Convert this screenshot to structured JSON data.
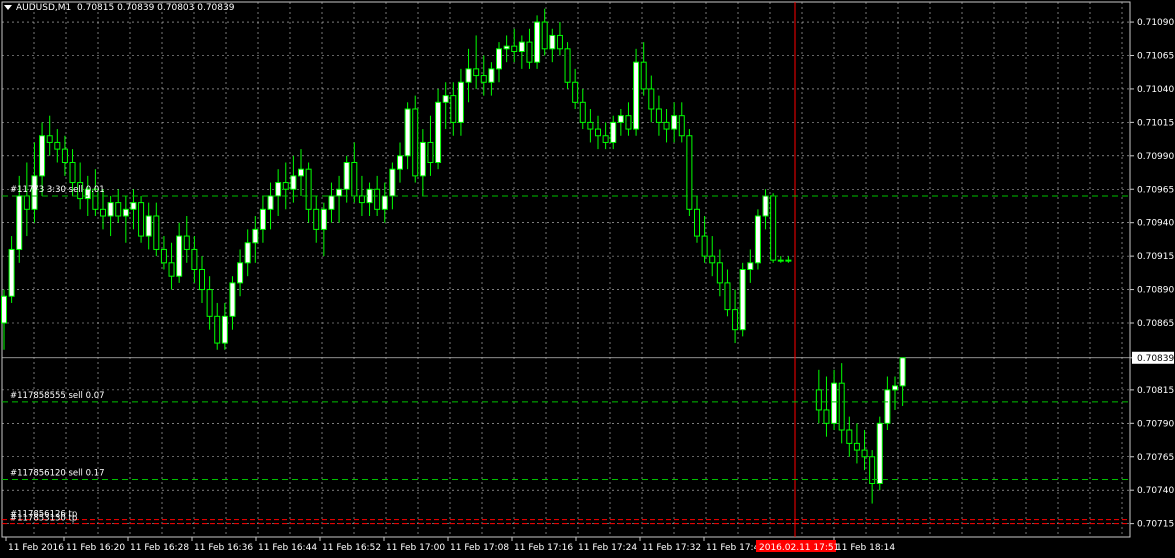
{
  "header": {
    "symbol_period": "AUDUSD,M1",
    "ohlc": "0.70815 0.70839 0.70803 0.70839"
  },
  "colors": {
    "background": "#000000",
    "grid": "#c8c8c8",
    "candle_up": "#ffffff",
    "candle_down_body": "#000000",
    "wick": "#00ff00",
    "order_line": "#00c000",
    "stop_line": "#ff0000",
    "vline": "#ff0000",
    "axis_text": "#ffffff",
    "time_marker_bg": "#ff0000"
  },
  "chart_data": {
    "type": "candlestick",
    "symbol": "AUDUSD",
    "timeframe": "M1",
    "ylim": [
      0.70705,
      0.71105
    ],
    "y_ticks": [
      "0.71090",
      "0.71065",
      "0.71040",
      "0.71015",
      "0.70990",
      "0.70965",
      "0.70940",
      "0.70915",
      "0.70890",
      "0.70865",
      "0.70839",
      "0.70815",
      "0.70790",
      "0.70765",
      "0.70740",
      "0.70715"
    ],
    "current_price": "0.70839",
    "x_ticks": [
      "11 Feb 2016",
      "11 Feb 16:20",
      "11 Feb 16:28",
      "11 Feb 16:36",
      "11 Feb 16:44",
      "11 Feb 16:52",
      "11 Feb 17:00",
      "11 Feb 17:08",
      "11 Feb 17:16",
      "11 Feb 17:24",
      "11 Feb 17:32",
      "11 Feb 17:4",
      "11 Feb 18:14"
    ],
    "time_marker": "2016.02.11 17:51",
    "orders": [
      {
        "label": "#11773 3:30 sell 0.01",
        "price": 0.7096
      },
      {
        "label": "#117858555 sell 0.07",
        "price": 0.70806
      },
      {
        "label": "#117856120 sell 0.17",
        "price": 0.70748
      },
      {
        "label": "#117856126 tp",
        "price": 0.70718
      },
      {
        "label": "#117853130 tp",
        "price": 0.70715
      }
    ],
    "candles": [
      {
        "o": 0.70865,
        "h": 0.7089,
        "l": 0.70845,
        "c": 0.70885
      },
      {
        "o": 0.70885,
        "h": 0.7093,
        "l": 0.7088,
        "c": 0.7092
      },
      {
        "o": 0.7092,
        "h": 0.70975,
        "l": 0.7091,
        "c": 0.7096
      },
      {
        "o": 0.7096,
        "h": 0.70985,
        "l": 0.7093,
        "c": 0.7095
      },
      {
        "o": 0.7095,
        "h": 0.71,
        "l": 0.7094,
        "c": 0.70975
      },
      {
        "o": 0.70975,
        "h": 0.71015,
        "l": 0.7096,
        "c": 0.71005
      },
      {
        "o": 0.71005,
        "h": 0.7102,
        "l": 0.7099,
        "c": 0.71
      },
      {
        "o": 0.71,
        "h": 0.7101,
        "l": 0.70985,
        "c": 0.70995
      },
      {
        "o": 0.70995,
        "h": 0.71005,
        "l": 0.70975,
        "c": 0.70985
      },
      {
        "o": 0.70985,
        "h": 0.70995,
        "l": 0.7096,
        "c": 0.7097
      },
      {
        "o": 0.7097,
        "h": 0.70985,
        "l": 0.7095,
        "c": 0.70958
      },
      {
        "o": 0.70958,
        "h": 0.70975,
        "l": 0.70945,
        "c": 0.70965
      },
      {
        "o": 0.70965,
        "h": 0.7098,
        "l": 0.70945,
        "c": 0.7095
      },
      {
        "o": 0.7095,
        "h": 0.70965,
        "l": 0.70935,
        "c": 0.70945
      },
      {
        "o": 0.70945,
        "h": 0.7096,
        "l": 0.7093,
        "c": 0.70955
      },
      {
        "o": 0.70955,
        "h": 0.70965,
        "l": 0.7094,
        "c": 0.70945
      },
      {
        "o": 0.70945,
        "h": 0.7096,
        "l": 0.70925,
        "c": 0.7095
      },
      {
        "o": 0.7095,
        "h": 0.70965,
        "l": 0.70935,
        "c": 0.70955
      },
      {
        "o": 0.70955,
        "h": 0.7096,
        "l": 0.70925,
        "c": 0.7093
      },
      {
        "o": 0.7093,
        "h": 0.70955,
        "l": 0.7092,
        "c": 0.70945
      },
      {
        "o": 0.70945,
        "h": 0.70955,
        "l": 0.70915,
        "c": 0.7092
      },
      {
        "o": 0.7092,
        "h": 0.7093,
        "l": 0.70905,
        "c": 0.7091
      },
      {
        "o": 0.7091,
        "h": 0.70925,
        "l": 0.7089,
        "c": 0.709
      },
      {
        "o": 0.709,
        "h": 0.7094,
        "l": 0.70895,
        "c": 0.7093
      },
      {
        "o": 0.7093,
        "h": 0.70945,
        "l": 0.7091,
        "c": 0.7092
      },
      {
        "o": 0.7092,
        "h": 0.7093,
        "l": 0.70895,
        "c": 0.70905
      },
      {
        "o": 0.70905,
        "h": 0.70915,
        "l": 0.7088,
        "c": 0.7089
      },
      {
        "o": 0.7089,
        "h": 0.709,
        "l": 0.7086,
        "c": 0.7087
      },
      {
        "o": 0.7087,
        "h": 0.7088,
        "l": 0.70845,
        "c": 0.7085
      },
      {
        "o": 0.7085,
        "h": 0.7088,
        "l": 0.70845,
        "c": 0.7087
      },
      {
        "o": 0.7087,
        "h": 0.709,
        "l": 0.7086,
        "c": 0.70895
      },
      {
        "o": 0.70895,
        "h": 0.7092,
        "l": 0.70885,
        "c": 0.7091
      },
      {
        "o": 0.7091,
        "h": 0.70935,
        "l": 0.709,
        "c": 0.70925
      },
      {
        "o": 0.70925,
        "h": 0.70945,
        "l": 0.7091,
        "c": 0.70935
      },
      {
        "o": 0.70935,
        "h": 0.7096,
        "l": 0.70925,
        "c": 0.7095
      },
      {
        "o": 0.7095,
        "h": 0.7097,
        "l": 0.70935,
        "c": 0.7096
      },
      {
        "o": 0.7096,
        "h": 0.7098,
        "l": 0.70945,
        "c": 0.7097
      },
      {
        "o": 0.7097,
        "h": 0.70985,
        "l": 0.7095,
        "c": 0.70965
      },
      {
        "o": 0.70965,
        "h": 0.7099,
        "l": 0.70955,
        "c": 0.70975
      },
      {
        "o": 0.70975,
        "h": 0.70995,
        "l": 0.7096,
        "c": 0.7098
      },
      {
        "o": 0.7098,
        "h": 0.70985,
        "l": 0.7094,
        "c": 0.7095
      },
      {
        "o": 0.7095,
        "h": 0.7096,
        "l": 0.70925,
        "c": 0.70935
      },
      {
        "o": 0.70935,
        "h": 0.70955,
        "l": 0.70915,
        "c": 0.7095
      },
      {
        "o": 0.7095,
        "h": 0.7097,
        "l": 0.7094,
        "c": 0.7096
      },
      {
        "o": 0.7096,
        "h": 0.70975,
        "l": 0.7094,
        "c": 0.70965
      },
      {
        "o": 0.70965,
        "h": 0.7099,
        "l": 0.70955,
        "c": 0.70985
      },
      {
        "o": 0.70985,
        "h": 0.71,
        "l": 0.70955,
        "c": 0.7096
      },
      {
        "o": 0.7096,
        "h": 0.70975,
        "l": 0.70945,
        "c": 0.70955
      },
      {
        "o": 0.70955,
        "h": 0.7097,
        "l": 0.70945,
        "c": 0.70965
      },
      {
        "o": 0.70965,
        "h": 0.70975,
        "l": 0.70945,
        "c": 0.7095
      },
      {
        "o": 0.7095,
        "h": 0.7097,
        "l": 0.7094,
        "c": 0.7096
      },
      {
        "o": 0.7096,
        "h": 0.70985,
        "l": 0.7095,
        "c": 0.7098
      },
      {
        "o": 0.7098,
        "h": 0.71,
        "l": 0.7097,
        "c": 0.7099
      },
      {
        "o": 0.7099,
        "h": 0.7103,
        "l": 0.7098,
        "c": 0.71025
      },
      {
        "o": 0.71025,
        "h": 0.71035,
        "l": 0.7097,
        "c": 0.70975
      },
      {
        "o": 0.70975,
        "h": 0.7101,
        "l": 0.7096,
        "c": 0.71
      },
      {
        "o": 0.71,
        "h": 0.7102,
        "l": 0.70975,
        "c": 0.70985
      },
      {
        "o": 0.70985,
        "h": 0.7104,
        "l": 0.7098,
        "c": 0.7103
      },
      {
        "o": 0.7103,
        "h": 0.71045,
        "l": 0.7101,
        "c": 0.71035
      },
      {
        "o": 0.71035,
        "h": 0.71045,
        "l": 0.71005,
        "c": 0.71015
      },
      {
        "o": 0.71015,
        "h": 0.71055,
        "l": 0.71005,
        "c": 0.71045
      },
      {
        "o": 0.71045,
        "h": 0.7107,
        "l": 0.7103,
        "c": 0.71055
      },
      {
        "o": 0.71055,
        "h": 0.7108,
        "l": 0.7104,
        "c": 0.7105
      },
      {
        "o": 0.7105,
        "h": 0.71065,
        "l": 0.71035,
        "c": 0.71045
      },
      {
        "o": 0.71045,
        "h": 0.7106,
        "l": 0.71035,
        "c": 0.71055
      },
      {
        "o": 0.71055,
        "h": 0.71075,
        "l": 0.71045,
        "c": 0.7107
      },
      {
        "o": 0.7107,
        "h": 0.7108,
        "l": 0.7106,
        "c": 0.71072
      },
      {
        "o": 0.71072,
        "h": 0.71085,
        "l": 0.7106,
        "c": 0.71068
      },
      {
        "o": 0.71068,
        "h": 0.7108,
        "l": 0.71055,
        "c": 0.71075
      },
      {
        "o": 0.71075,
        "h": 0.71085,
        "l": 0.71055,
        "c": 0.7106
      },
      {
        "o": 0.7106,
        "h": 0.71095,
        "l": 0.71055,
        "c": 0.7109
      },
      {
        "o": 0.7109,
        "h": 0.711,
        "l": 0.71065,
        "c": 0.7107
      },
      {
        "o": 0.7107,
        "h": 0.71085,
        "l": 0.7106,
        "c": 0.7108
      },
      {
        "o": 0.7108,
        "h": 0.7109,
        "l": 0.71065,
        "c": 0.7107
      },
      {
        "o": 0.7107,
        "h": 0.71075,
        "l": 0.7104,
        "c": 0.71045
      },
      {
        "o": 0.71045,
        "h": 0.71055,
        "l": 0.71025,
        "c": 0.7103
      },
      {
        "o": 0.7103,
        "h": 0.7104,
        "l": 0.7101,
        "c": 0.71015
      },
      {
        "o": 0.71015,
        "h": 0.71025,
        "l": 0.71,
        "c": 0.7101
      },
      {
        "o": 0.7101,
        "h": 0.7102,
        "l": 0.70995,
        "c": 0.71005
      },
      {
        "o": 0.71005,
        "h": 0.71015,
        "l": 0.70995,
        "c": 0.71
      },
      {
        "o": 0.71,
        "h": 0.7102,
        "l": 0.70995,
        "c": 0.71015
      },
      {
        "o": 0.71015,
        "h": 0.71025,
        "l": 0.71005,
        "c": 0.7102
      },
      {
        "o": 0.7102,
        "h": 0.7103,
        "l": 0.71005,
        "c": 0.7101
      },
      {
        "o": 0.7101,
        "h": 0.7107,
        "l": 0.71005,
        "c": 0.7106
      },
      {
        "o": 0.7106,
        "h": 0.71075,
        "l": 0.71035,
        "c": 0.7104
      },
      {
        "o": 0.7104,
        "h": 0.7105,
        "l": 0.71015,
        "c": 0.71025
      },
      {
        "o": 0.71025,
        "h": 0.71035,
        "l": 0.71005,
        "c": 0.71015
      },
      {
        "o": 0.71015,
        "h": 0.71025,
        "l": 0.71,
        "c": 0.7101
      },
      {
        "o": 0.7101,
        "h": 0.7103,
        "l": 0.71,
        "c": 0.7102
      },
      {
        "o": 0.7102,
        "h": 0.7103,
        "l": 0.71,
        "c": 0.71005
      },
      {
        "o": 0.71005,
        "h": 0.7101,
        "l": 0.70945,
        "c": 0.7095
      },
      {
        "o": 0.7095,
        "h": 0.7096,
        "l": 0.70925,
        "c": 0.7093
      },
      {
        "o": 0.7093,
        "h": 0.70945,
        "l": 0.7091,
        "c": 0.70915
      },
      {
        "o": 0.70915,
        "h": 0.7093,
        "l": 0.709,
        "c": 0.7091
      },
      {
        "o": 0.7091,
        "h": 0.7092,
        "l": 0.70885,
        "c": 0.70895
      },
      {
        "o": 0.70895,
        "h": 0.70905,
        "l": 0.7087,
        "c": 0.70875
      },
      {
        "o": 0.70875,
        "h": 0.7089,
        "l": 0.7085,
        "c": 0.7086
      },
      {
        "o": 0.7086,
        "h": 0.7091,
        "l": 0.70855,
        "c": 0.70905
      },
      {
        "o": 0.70905,
        "h": 0.7092,
        "l": 0.70895,
        "c": 0.7091
      },
      {
        "o": 0.7091,
        "h": 0.7095,
        "l": 0.70905,
        "c": 0.70945
      },
      {
        "o": 0.70945,
        "h": 0.70965,
        "l": 0.70935,
        "c": 0.7096
      },
      {
        "o": 0.7096,
        "h": 0.70962,
        "l": 0.7091,
        "c": 0.70912
      },
      {
        "o": 0.70912,
        "h": 0.70915,
        "l": 0.7091,
        "c": 0.70912
      },
      {
        "o": 0.70912,
        "h": 0.70915,
        "l": 0.7091,
        "c": 0.70912
      },
      {
        "gap": true
      },
      {
        "gap": true
      },
      {
        "gap": true
      },
      {
        "o": 0.70815,
        "h": 0.7083,
        "l": 0.7079,
        "c": 0.708
      },
      {
        "o": 0.708,
        "h": 0.70825,
        "l": 0.7078,
        "c": 0.7079
      },
      {
        "o": 0.7079,
        "h": 0.7083,
        "l": 0.70785,
        "c": 0.7082
      },
      {
        "o": 0.7082,
        "h": 0.70835,
        "l": 0.70775,
        "c": 0.70785
      },
      {
        "o": 0.70785,
        "h": 0.70795,
        "l": 0.70765,
        "c": 0.70775
      },
      {
        "o": 0.70775,
        "h": 0.7079,
        "l": 0.7076,
        "c": 0.7077
      },
      {
        "o": 0.7077,
        "h": 0.70785,
        "l": 0.70755,
        "c": 0.70765
      },
      {
        "o": 0.70765,
        "h": 0.7077,
        "l": 0.7073,
        "c": 0.70745
      },
      {
        "o": 0.70745,
        "h": 0.70795,
        "l": 0.7074,
        "c": 0.7079
      },
      {
        "o": 0.7079,
        "h": 0.70825,
        "l": 0.70785,
        "c": 0.70815
      },
      {
        "o": 0.70815,
        "h": 0.70825,
        "l": 0.708,
        "c": 0.70818
      },
      {
        "o": 0.70818,
        "h": 0.70839,
        "l": 0.70803,
        "c": 0.70839
      }
    ]
  }
}
